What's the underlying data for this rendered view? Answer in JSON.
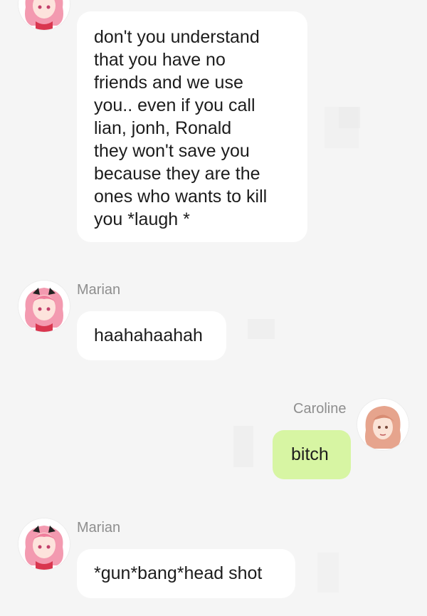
{
  "messages": [
    {
      "sender": "",
      "text": "don't you understand\nthat you have no\nfriends and we use\nyou.. even if you call\nlian, jonh, Ronald\nthey won't save you\nbecause they are the\nones who wants to kill\nyou *laugh *",
      "side": "left",
      "avatar": "pink-hair-girl-avatar"
    },
    {
      "sender": "Marian",
      "text": "haahahaahah",
      "side": "left",
      "avatar": "pink-hair-girl-avatar"
    },
    {
      "sender": "Caroline",
      "text": "bitch",
      "side": "right",
      "avatar": "light-brown-hair-girl-avatar"
    },
    {
      "sender": "Marian",
      "text": "*gun*bang*head shot",
      "side": "left",
      "avatar": "pink-hair-girl-avatar"
    }
  ],
  "colors": {
    "background": "#f5f5f5",
    "bubble_other": "#ffffff",
    "bubble_self": "#d7f5a3",
    "sender_name": "#8e8e8e"
  }
}
